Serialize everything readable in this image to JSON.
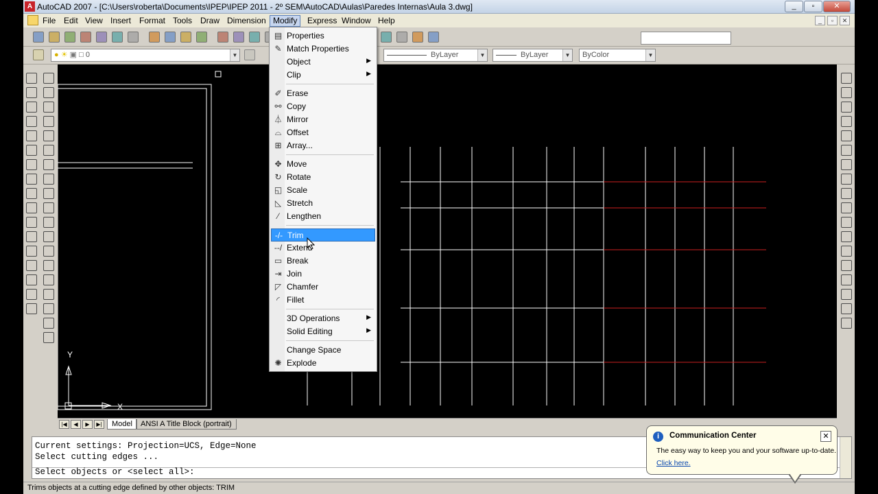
{
  "window": {
    "title": "AutoCAD 2007 - [C:\\Users\\roberta\\Documents\\IPEP\\IPEP 2011 - 2º SEM\\AutoCAD\\Aulas\\Paredes Internas\\Aula 3.dwg]",
    "minimize": "_",
    "maximize": "▫",
    "close": "✕"
  },
  "menubar": {
    "items": [
      "File",
      "Edit",
      "View",
      "Insert",
      "Format",
      "Tools",
      "Draw",
      "Dimension",
      "Modify",
      "Express",
      "Window",
      "Help"
    ],
    "open_menu": "Modify",
    "mdi_minimize": "_",
    "mdi_restore": "▫",
    "mdi_close": "✕"
  },
  "layer_toolbar": {
    "current_layer": "0",
    "color": "ByColor",
    "linetype": "ByLayer",
    "lineweight": "ByLayer"
  },
  "modify_menu": {
    "groups": [
      [
        {
          "label": "Properties",
          "icon": "properties-icon",
          "glyph": "▤"
        },
        {
          "label": "Match Properties",
          "icon": "match-properties-icon",
          "glyph": "✎"
        },
        {
          "label": "Object",
          "icon": "",
          "glyph": "",
          "submenu": true
        },
        {
          "label": "Clip",
          "icon": "",
          "glyph": "",
          "submenu": true
        }
      ],
      [
        {
          "label": "Erase",
          "icon": "erase-icon",
          "glyph": "✐"
        },
        {
          "label": "Copy",
          "icon": "copy-icon",
          "glyph": "⚯"
        },
        {
          "label": "Mirror",
          "icon": "mirror-icon",
          "glyph": "⏃"
        },
        {
          "label": "Offset",
          "icon": "offset-icon",
          "glyph": "⌓"
        },
        {
          "label": "Array...",
          "icon": "array-icon",
          "glyph": "⊞"
        }
      ],
      [
        {
          "label": "Move",
          "icon": "move-icon",
          "glyph": "✥"
        },
        {
          "label": "Rotate",
          "icon": "rotate-icon",
          "glyph": "↻"
        },
        {
          "label": "Scale",
          "icon": "scale-icon",
          "glyph": "◱"
        },
        {
          "label": "Stretch",
          "icon": "stretch-icon",
          "glyph": "◺"
        },
        {
          "label": "Lengthen",
          "icon": "lengthen-icon",
          "glyph": "⁄"
        }
      ],
      [
        {
          "label": "Trim",
          "icon": "trim-icon",
          "glyph": "-/-",
          "highlighted": true
        },
        {
          "label": "Extend",
          "icon": "extend-icon",
          "glyph": "--/"
        },
        {
          "label": "Break",
          "icon": "break-icon",
          "glyph": "▭"
        },
        {
          "label": "Join",
          "icon": "join-icon",
          "glyph": "⇥"
        },
        {
          "label": "Chamfer",
          "icon": "chamfer-icon",
          "glyph": "◸"
        },
        {
          "label": "Fillet",
          "icon": "fillet-icon",
          "glyph": "◜"
        }
      ],
      [
        {
          "label": "3D Operations",
          "icon": "",
          "glyph": "",
          "submenu": true
        },
        {
          "label": "Solid Editing",
          "icon": "",
          "glyph": "",
          "submenu": true
        }
      ],
      [
        {
          "label": "Change Space",
          "icon": "",
          "glyph": ""
        },
        {
          "label": "Explode",
          "icon": "explode-icon",
          "glyph": "✺"
        }
      ]
    ]
  },
  "layout_tabs": {
    "tabs": [
      "Model",
      "ANSI A Title Block (portrait)"
    ],
    "active": "Model"
  },
  "ucs": {
    "x": "X",
    "y": "Y"
  },
  "command_line": {
    "history": [
      "Current settings: Projection=UCS, Edge=None",
      "Select cutting edges ..."
    ],
    "prompt": "Select objects or <select all>:"
  },
  "status_bar": {
    "text": "Trims objects at a cutting edge defined by other objects:  TRIM"
  },
  "notification": {
    "title": "Communication Center",
    "body": "The easy way to keep you and your software up-to-date.",
    "link": "Click here.",
    "close": "✕",
    "icon": "info-icon"
  },
  "colors": {
    "canvas_background": "#000000",
    "grid_line": "#ffffff",
    "red_line": "#cc1f1f",
    "menu_highlight": "#3399ff"
  },
  "toolbar_icons": {
    "standard": [
      "new-icon",
      "open-icon",
      "save-icon",
      "plot-icon",
      "plot-preview-icon",
      "publish-icon",
      "3d-dwf-icon",
      "cut-icon",
      "copy-clip-icon",
      "paste-icon",
      "match-prop-icon",
      "block-editor-icon",
      "undo-icon",
      "redo-icon",
      "pan-icon",
      "zoom-realtime-icon",
      "zoom-window-icon",
      "zoom-previous-icon",
      "properties-palette-icon",
      "designcenter-icon",
      "tool-palettes-icon",
      "sheet-set-icon",
      "markup-icon",
      "calculator-icon",
      "help-icon"
    ],
    "draw": [
      "line-icon",
      "construction-line-icon",
      "polyline-icon",
      "polygon-icon",
      "rectangle-icon",
      "arc-icon",
      "circle-icon",
      "revision-cloud-icon",
      "spline-icon",
      "ellipse-icon",
      "ellipse-arc-icon",
      "insert-block-icon",
      "make-block-icon",
      "point-icon",
      "hatch-icon",
      "gradient-icon",
      "region-icon",
      "table-icon",
      "multiline-text-icon"
    ],
    "modify": [
      "erase-icon",
      "copy-icon",
      "mirror-icon",
      "offset-icon",
      "array-icon",
      "move-icon",
      "rotate-icon",
      "scale-icon",
      "stretch-icon",
      "trim-icon",
      "extend-icon",
      "break-at-point-icon",
      "break-icon",
      "join-icon",
      "chamfer-icon",
      "fillet-icon",
      "explode-icon"
    ],
    "dimension": [
      "linear-dim-icon",
      "aligned-dim-icon",
      "arc-length-icon",
      "ordinate-icon",
      "radius-icon",
      "jogged-icon",
      "diameter-icon",
      "angular-icon",
      "quick-dim-icon",
      "baseline-icon",
      "continue-icon",
      "quick-leader-icon",
      "tolerance-icon",
      "center-mark-icon",
      "dim-edit-icon",
      "dim-text-edit-icon",
      "dim-update-icon",
      "dim-style-icon"
    ]
  }
}
